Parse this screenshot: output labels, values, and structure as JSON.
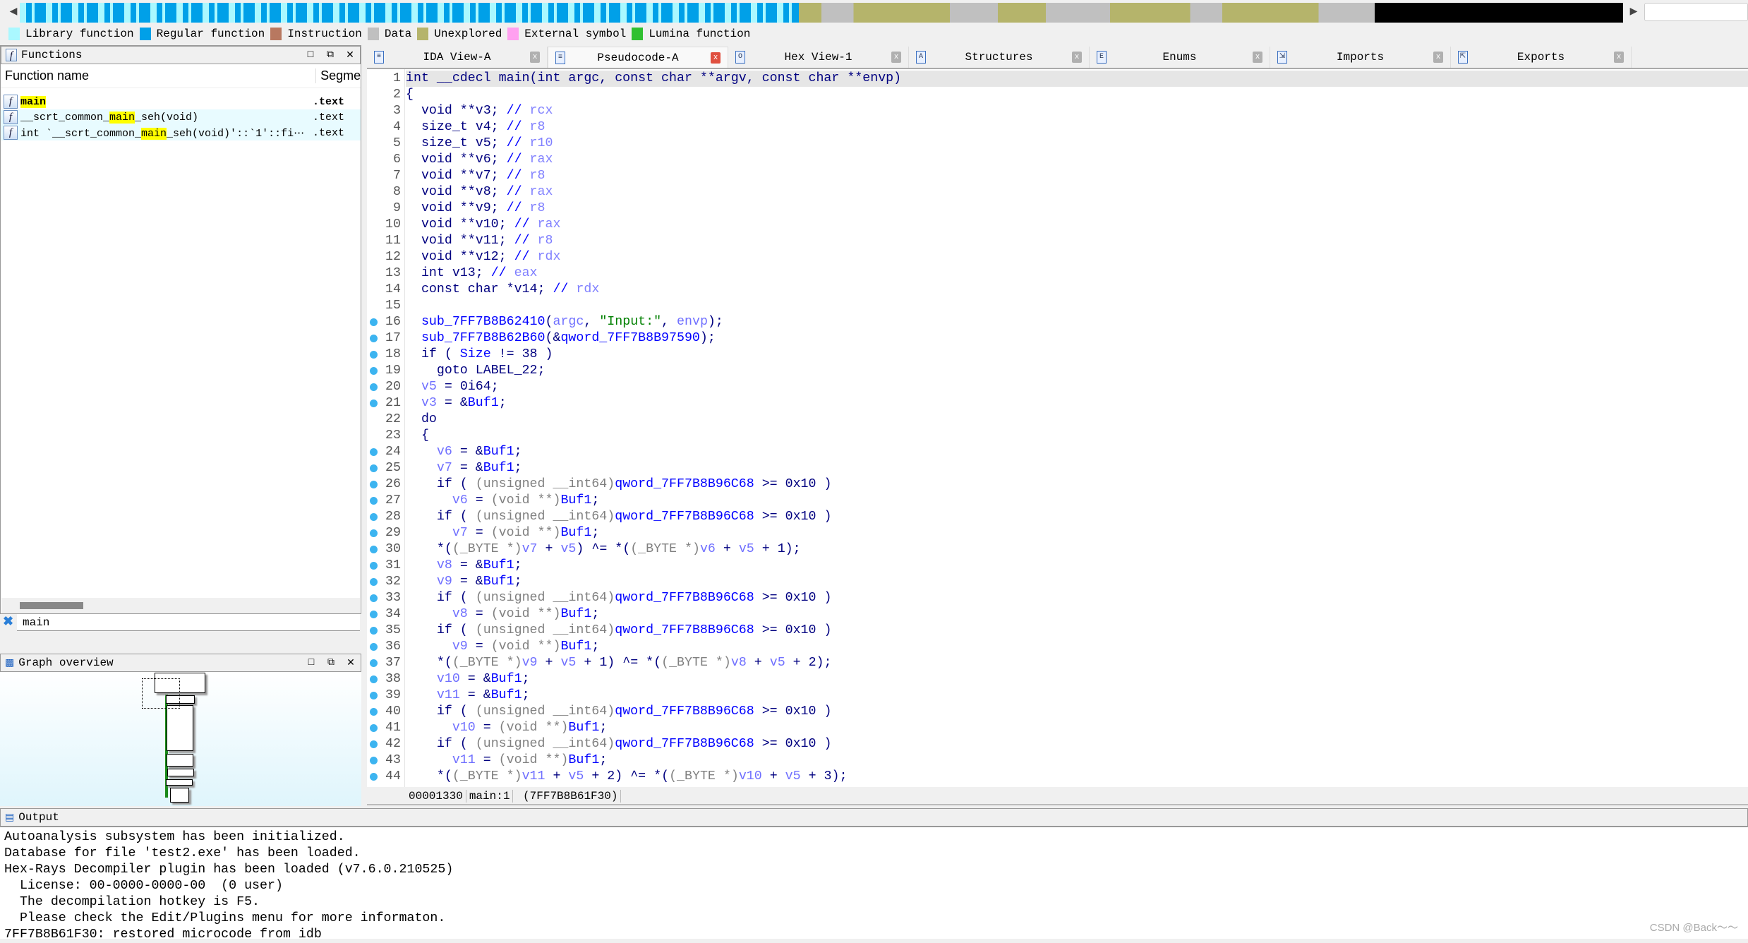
{
  "navbar": {
    "colors": {
      "library": "#aaf8ff",
      "regular": "#00a0e8",
      "instruction": "#b87860",
      "data": "#c0c0c0",
      "unexplored": "#b5b46b",
      "external": "#ffa0f0",
      "lumina": "#30c030"
    }
  },
  "legend": [
    {
      "label": "Library function",
      "color": "#aaf8ff"
    },
    {
      "label": "Regular function",
      "color": "#00a0e8"
    },
    {
      "label": "Instruction",
      "color": "#b87860"
    },
    {
      "label": "Data",
      "color": "#c0c0c0"
    },
    {
      "label": "Unexplored",
      "color": "#b5b46b"
    },
    {
      "label": "External symbol",
      "color": "#ffa0f0"
    },
    {
      "label": "Lumina function",
      "color": "#30c030"
    }
  ],
  "functions": {
    "title": "Functions",
    "columns": [
      "Function name",
      "Segme"
    ],
    "rows": [
      {
        "pre": "",
        "hl": "main",
        "post": "",
        "seg": ".text",
        "bold": true
      },
      {
        "pre": "__scrt_common_",
        "hl": "main",
        "post": "_seh(void)",
        "seg": ".text"
      },
      {
        "pre": "int `__scrt_common_",
        "hl": "main",
        "post": "_seh(void)'::`1'::fi⋯",
        "seg": ".text"
      }
    ],
    "filter": "main"
  },
  "graph": {
    "title": "Graph overview"
  },
  "tabs": [
    {
      "label": "IDA View-A",
      "icon": "disasm-icon"
    },
    {
      "label": "Pseudocode-A",
      "icon": "pseudocode-icon",
      "active": true
    },
    {
      "label": "Hex View-1",
      "icon": "hex-icon"
    },
    {
      "label": "Structures",
      "icon": "structures-icon"
    },
    {
      "label": "Enums",
      "icon": "enums-icon"
    },
    {
      "label": "Imports",
      "icon": "imports-icon"
    },
    {
      "label": "Exports",
      "icon": "exports-icon"
    }
  ],
  "code": [
    {
      "n": 1,
      "tk": [
        [
          "t",
          "int __cdecl main(int argc, const char **argv, const char **envp)"
        ]
      ]
    },
    {
      "n": 2,
      "tk": [
        [
          "t",
          "{"
        ]
      ]
    },
    {
      "n": 3,
      "tk": [
        [
          "t",
          "  void **v3; "
        ],
        [
          "g",
          "// "
        ],
        [
          "r",
          "rcx"
        ]
      ]
    },
    {
      "n": 4,
      "tk": [
        [
          "t",
          "  size_t v4; "
        ],
        [
          "g",
          "// "
        ],
        [
          "r",
          "r8"
        ]
      ]
    },
    {
      "n": 5,
      "tk": [
        [
          "t",
          "  size_t v5; "
        ],
        [
          "g",
          "// "
        ],
        [
          "r",
          "r10"
        ]
      ]
    },
    {
      "n": 6,
      "tk": [
        [
          "t",
          "  void **v6; "
        ],
        [
          "g",
          "// "
        ],
        [
          "r",
          "rax"
        ]
      ]
    },
    {
      "n": 7,
      "tk": [
        [
          "t",
          "  void **v7; "
        ],
        [
          "g",
          "// "
        ],
        [
          "r",
          "r8"
        ]
      ]
    },
    {
      "n": 8,
      "tk": [
        [
          "t",
          "  void **v8; "
        ],
        [
          "g",
          "// "
        ],
        [
          "r",
          "rax"
        ]
      ]
    },
    {
      "n": 9,
      "tk": [
        [
          "t",
          "  void **v9; "
        ],
        [
          "g",
          "// "
        ],
        [
          "r",
          "r8"
        ]
      ]
    },
    {
      "n": 10,
      "tk": [
        [
          "t",
          "  void **v10; "
        ],
        [
          "g",
          "// "
        ],
        [
          "r",
          "rax"
        ]
      ]
    },
    {
      "n": 11,
      "tk": [
        [
          "t",
          "  void **v11; "
        ],
        [
          "g",
          "// "
        ],
        [
          "r",
          "r8"
        ]
      ]
    },
    {
      "n": 12,
      "tk": [
        [
          "t",
          "  void **v12; "
        ],
        [
          "g",
          "// "
        ],
        [
          "r",
          "rdx"
        ]
      ]
    },
    {
      "n": 13,
      "tk": [
        [
          "t",
          "  int v13; "
        ],
        [
          "g",
          "// "
        ],
        [
          "r",
          "eax"
        ]
      ]
    },
    {
      "n": 14,
      "tk": [
        [
          "t",
          "  const char *v14; "
        ],
        [
          "g",
          "// "
        ],
        [
          "r",
          "rdx"
        ]
      ]
    },
    {
      "n": 15,
      "tk": []
    },
    {
      "n": 16,
      "bp": true,
      "tk": [
        [
          "t",
          "  "
        ],
        [
          "g",
          "sub_7FF7B8B62410"
        ],
        [
          "t",
          "("
        ],
        [
          "v",
          "argc"
        ],
        [
          "t",
          ", "
        ],
        [
          "s",
          "\"Input:\""
        ],
        [
          "t",
          ", "
        ],
        [
          "v",
          "envp"
        ],
        [
          "t",
          ");"
        ]
      ]
    },
    {
      "n": 17,
      "bp": true,
      "tk": [
        [
          "t",
          "  "
        ],
        [
          "g",
          "sub_7FF7B8B62B60"
        ],
        [
          "t",
          "(&"
        ],
        [
          "g",
          "qword_7FF7B8B97590"
        ],
        [
          "t",
          ");"
        ]
      ]
    },
    {
      "n": 18,
      "bp": true,
      "tk": [
        [
          "t",
          "  if ( "
        ],
        [
          "g",
          "Size"
        ],
        [
          "t",
          " != 38 )"
        ]
      ]
    },
    {
      "n": 19,
      "bp": true,
      "tk": [
        [
          "t",
          "    goto LABEL_22;"
        ]
      ]
    },
    {
      "n": 20,
      "bp": true,
      "tk": [
        [
          "t",
          "  "
        ],
        [
          "v",
          "v5"
        ],
        [
          "t",
          " = 0i64;"
        ]
      ]
    },
    {
      "n": 21,
      "bp": true,
      "tk": [
        [
          "t",
          "  "
        ],
        [
          "v",
          "v3"
        ],
        [
          "t",
          " = &"
        ],
        [
          "g",
          "Buf1"
        ],
        [
          "t",
          ";"
        ]
      ]
    },
    {
      "n": 22,
      "tk": [
        [
          "t",
          "  do"
        ]
      ]
    },
    {
      "n": 23,
      "tk": [
        [
          "t",
          "  {"
        ]
      ]
    },
    {
      "n": 24,
      "bp": true,
      "tk": [
        [
          "t",
          "    "
        ],
        [
          "v",
          "v6"
        ],
        [
          "t",
          " = &"
        ],
        [
          "g",
          "Buf1"
        ],
        [
          "t",
          ";"
        ]
      ]
    },
    {
      "n": 25,
      "bp": true,
      "tk": [
        [
          "t",
          "    "
        ],
        [
          "v",
          "v7"
        ],
        [
          "t",
          " = &"
        ],
        [
          "g",
          "Buf1"
        ],
        [
          "t",
          ";"
        ]
      ]
    },
    {
      "n": 26,
      "bp": true,
      "tk": [
        [
          "t",
          "    if ( "
        ],
        [
          "c",
          "(unsigned __int64)"
        ],
        [
          "g",
          "qword_7FF7B8B96C68"
        ],
        [
          "t",
          " >= 0x10 )"
        ]
      ]
    },
    {
      "n": 27,
      "bp": true,
      "tk": [
        [
          "t",
          "      "
        ],
        [
          "v",
          "v6"
        ],
        [
          "t",
          " = "
        ],
        [
          "c",
          "(void **)"
        ],
        [
          "g",
          "Buf1"
        ],
        [
          "t",
          ";"
        ]
      ]
    },
    {
      "n": 28,
      "bp": true,
      "tk": [
        [
          "t",
          "    if ( "
        ],
        [
          "c",
          "(unsigned __int64)"
        ],
        [
          "g",
          "qword_7FF7B8B96C68"
        ],
        [
          "t",
          " >= 0x10 )"
        ]
      ]
    },
    {
      "n": 29,
      "bp": true,
      "tk": [
        [
          "t",
          "      "
        ],
        [
          "v",
          "v7"
        ],
        [
          "t",
          " = "
        ],
        [
          "c",
          "(void **)"
        ],
        [
          "g",
          "Buf1"
        ],
        [
          "t",
          ";"
        ]
      ]
    },
    {
      "n": 30,
      "bp": true,
      "tk": [
        [
          "t",
          "    *("
        ],
        [
          "c",
          "(_BYTE *)"
        ],
        [
          "v",
          "v7"
        ],
        [
          "t",
          " + "
        ],
        [
          "v",
          "v5"
        ],
        [
          "t",
          ") ^= *("
        ],
        [
          "c",
          "(_BYTE *)"
        ],
        [
          "v",
          "v6"
        ],
        [
          "t",
          " + "
        ],
        [
          "v",
          "v5"
        ],
        [
          "t",
          " + 1);"
        ]
      ]
    },
    {
      "n": 31,
      "bp": true,
      "tk": [
        [
          "t",
          "    "
        ],
        [
          "v",
          "v8"
        ],
        [
          "t",
          " = &"
        ],
        [
          "g",
          "Buf1"
        ],
        [
          "t",
          ";"
        ]
      ]
    },
    {
      "n": 32,
      "bp": true,
      "tk": [
        [
          "t",
          "    "
        ],
        [
          "v",
          "v9"
        ],
        [
          "t",
          " = &"
        ],
        [
          "g",
          "Buf1"
        ],
        [
          "t",
          ";"
        ]
      ]
    },
    {
      "n": 33,
      "bp": true,
      "tk": [
        [
          "t",
          "    if ( "
        ],
        [
          "c",
          "(unsigned __int64)"
        ],
        [
          "g",
          "qword_7FF7B8B96C68"
        ],
        [
          "t",
          " >= 0x10 )"
        ]
      ]
    },
    {
      "n": 34,
      "bp": true,
      "tk": [
        [
          "t",
          "      "
        ],
        [
          "v",
          "v8"
        ],
        [
          "t",
          " = "
        ],
        [
          "c",
          "(void **)"
        ],
        [
          "g",
          "Buf1"
        ],
        [
          "t",
          ";"
        ]
      ]
    },
    {
      "n": 35,
      "bp": true,
      "tk": [
        [
          "t",
          "    if ( "
        ],
        [
          "c",
          "(unsigned __int64)"
        ],
        [
          "g",
          "qword_7FF7B8B96C68"
        ],
        [
          "t",
          " >= 0x10 )"
        ]
      ]
    },
    {
      "n": 36,
      "bp": true,
      "tk": [
        [
          "t",
          "      "
        ],
        [
          "v",
          "v9"
        ],
        [
          "t",
          " = "
        ],
        [
          "c",
          "(void **)"
        ],
        [
          "g",
          "Buf1"
        ],
        [
          "t",
          ";"
        ]
      ]
    },
    {
      "n": 37,
      "bp": true,
      "tk": [
        [
          "t",
          "    *("
        ],
        [
          "c",
          "(_BYTE *)"
        ],
        [
          "v",
          "v9"
        ],
        [
          "t",
          " + "
        ],
        [
          "v",
          "v5"
        ],
        [
          "t",
          " + 1) ^= *("
        ],
        [
          "c",
          "(_BYTE *)"
        ],
        [
          "v",
          "v8"
        ],
        [
          "t",
          " + "
        ],
        [
          "v",
          "v5"
        ],
        [
          "t",
          " + 2);"
        ]
      ]
    },
    {
      "n": 38,
      "bp": true,
      "tk": [
        [
          "t",
          "    "
        ],
        [
          "v",
          "v10"
        ],
        [
          "t",
          " = &"
        ],
        [
          "g",
          "Buf1"
        ],
        [
          "t",
          ";"
        ]
      ]
    },
    {
      "n": 39,
      "bp": true,
      "tk": [
        [
          "t",
          "    "
        ],
        [
          "v",
          "v11"
        ],
        [
          "t",
          " = &"
        ],
        [
          "g",
          "Buf1"
        ],
        [
          "t",
          ";"
        ]
      ]
    },
    {
      "n": 40,
      "bp": true,
      "tk": [
        [
          "t",
          "    if ( "
        ],
        [
          "c",
          "(unsigned __int64)"
        ],
        [
          "g",
          "qword_7FF7B8B96C68"
        ],
        [
          "t",
          " >= 0x10 )"
        ]
      ]
    },
    {
      "n": 41,
      "bp": true,
      "tk": [
        [
          "t",
          "      "
        ],
        [
          "v",
          "v10"
        ],
        [
          "t",
          " = "
        ],
        [
          "c",
          "(void **)"
        ],
        [
          "g",
          "Buf1"
        ],
        [
          "t",
          ";"
        ]
      ]
    },
    {
      "n": 42,
      "bp": true,
      "tk": [
        [
          "t",
          "    if ( "
        ],
        [
          "c",
          "(unsigned __int64)"
        ],
        [
          "g",
          "qword_7FF7B8B96C68"
        ],
        [
          "t",
          " >= 0x10 )"
        ]
      ]
    },
    {
      "n": 43,
      "bp": true,
      "tk": [
        [
          "t",
          "      "
        ],
        [
          "v",
          "v11"
        ],
        [
          "t",
          " = "
        ],
        [
          "c",
          "(void **)"
        ],
        [
          "g",
          "Buf1"
        ],
        [
          "t",
          ";"
        ]
      ]
    },
    {
      "n": 44,
      "bp": true,
      "tk": [
        [
          "t",
          "    *("
        ],
        [
          "c",
          "(_BYTE *)"
        ],
        [
          "v",
          "v11"
        ],
        [
          "t",
          " + "
        ],
        [
          "v",
          "v5"
        ],
        [
          "t",
          " + 2) ^= *("
        ],
        [
          "c",
          "(_BYTE *)"
        ],
        [
          "v",
          "v10"
        ],
        [
          "t",
          " + "
        ],
        [
          "v",
          "v5"
        ],
        [
          "t",
          " + 3);"
        ]
      ]
    }
  ],
  "status": {
    "offset": "00001330",
    "location": "main:1",
    "address": "(7FF7B8B61F30)"
  },
  "output": {
    "title": "Output",
    "lines": [
      "Autoanalysis subsystem has been initialized.",
      "Database for file 'test2.exe' has been loaded.",
      "Hex-Rays Decompiler plugin has been loaded (v7.6.0.210525)",
      "  License: 00-0000-0000-00  (0 user)",
      "  The decompilation hotkey is F5.",
      "  Please check the Edit/Plugins menu for more informaton.",
      "7FF7B8B61F30: restored microcode from idb"
    ]
  },
  "watermark": "CSDN @Back～～"
}
